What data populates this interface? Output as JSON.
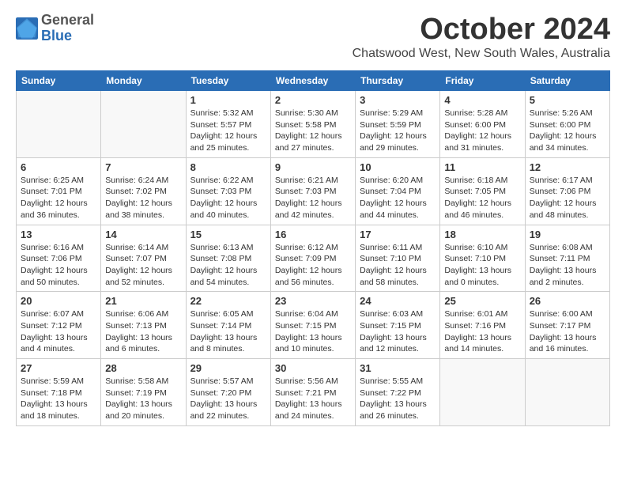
{
  "logo": {
    "text_general": "General",
    "text_blue": "Blue"
  },
  "title": "October 2024",
  "location": "Chatswood West, New South Wales, Australia",
  "days_of_week": [
    "Sunday",
    "Monday",
    "Tuesday",
    "Wednesday",
    "Thursday",
    "Friday",
    "Saturday"
  ],
  "weeks": [
    [
      {
        "day": "",
        "info": ""
      },
      {
        "day": "",
        "info": ""
      },
      {
        "day": "1",
        "info": "Sunrise: 5:32 AM\nSunset: 5:57 PM\nDaylight: 12 hours\nand 25 minutes."
      },
      {
        "day": "2",
        "info": "Sunrise: 5:30 AM\nSunset: 5:58 PM\nDaylight: 12 hours\nand 27 minutes."
      },
      {
        "day": "3",
        "info": "Sunrise: 5:29 AM\nSunset: 5:59 PM\nDaylight: 12 hours\nand 29 minutes."
      },
      {
        "day": "4",
        "info": "Sunrise: 5:28 AM\nSunset: 6:00 PM\nDaylight: 12 hours\nand 31 minutes."
      },
      {
        "day": "5",
        "info": "Sunrise: 5:26 AM\nSunset: 6:00 PM\nDaylight: 12 hours\nand 34 minutes."
      }
    ],
    [
      {
        "day": "6",
        "info": "Sunrise: 6:25 AM\nSunset: 7:01 PM\nDaylight: 12 hours\nand 36 minutes."
      },
      {
        "day": "7",
        "info": "Sunrise: 6:24 AM\nSunset: 7:02 PM\nDaylight: 12 hours\nand 38 minutes."
      },
      {
        "day": "8",
        "info": "Sunrise: 6:22 AM\nSunset: 7:03 PM\nDaylight: 12 hours\nand 40 minutes."
      },
      {
        "day": "9",
        "info": "Sunrise: 6:21 AM\nSunset: 7:03 PM\nDaylight: 12 hours\nand 42 minutes."
      },
      {
        "day": "10",
        "info": "Sunrise: 6:20 AM\nSunset: 7:04 PM\nDaylight: 12 hours\nand 44 minutes."
      },
      {
        "day": "11",
        "info": "Sunrise: 6:18 AM\nSunset: 7:05 PM\nDaylight: 12 hours\nand 46 minutes."
      },
      {
        "day": "12",
        "info": "Sunrise: 6:17 AM\nSunset: 7:06 PM\nDaylight: 12 hours\nand 48 minutes."
      }
    ],
    [
      {
        "day": "13",
        "info": "Sunrise: 6:16 AM\nSunset: 7:06 PM\nDaylight: 12 hours\nand 50 minutes."
      },
      {
        "day": "14",
        "info": "Sunrise: 6:14 AM\nSunset: 7:07 PM\nDaylight: 12 hours\nand 52 minutes."
      },
      {
        "day": "15",
        "info": "Sunrise: 6:13 AM\nSunset: 7:08 PM\nDaylight: 12 hours\nand 54 minutes."
      },
      {
        "day": "16",
        "info": "Sunrise: 6:12 AM\nSunset: 7:09 PM\nDaylight: 12 hours\nand 56 minutes."
      },
      {
        "day": "17",
        "info": "Sunrise: 6:11 AM\nSunset: 7:10 PM\nDaylight: 12 hours\nand 58 minutes."
      },
      {
        "day": "18",
        "info": "Sunrise: 6:10 AM\nSunset: 7:10 PM\nDaylight: 13 hours\nand 0 minutes."
      },
      {
        "day": "19",
        "info": "Sunrise: 6:08 AM\nSunset: 7:11 PM\nDaylight: 13 hours\nand 2 minutes."
      }
    ],
    [
      {
        "day": "20",
        "info": "Sunrise: 6:07 AM\nSunset: 7:12 PM\nDaylight: 13 hours\nand 4 minutes."
      },
      {
        "day": "21",
        "info": "Sunrise: 6:06 AM\nSunset: 7:13 PM\nDaylight: 13 hours\nand 6 minutes."
      },
      {
        "day": "22",
        "info": "Sunrise: 6:05 AM\nSunset: 7:14 PM\nDaylight: 13 hours\nand 8 minutes."
      },
      {
        "day": "23",
        "info": "Sunrise: 6:04 AM\nSunset: 7:15 PM\nDaylight: 13 hours\nand 10 minutes."
      },
      {
        "day": "24",
        "info": "Sunrise: 6:03 AM\nSunset: 7:15 PM\nDaylight: 13 hours\nand 12 minutes."
      },
      {
        "day": "25",
        "info": "Sunrise: 6:01 AM\nSunset: 7:16 PM\nDaylight: 13 hours\nand 14 minutes."
      },
      {
        "day": "26",
        "info": "Sunrise: 6:00 AM\nSunset: 7:17 PM\nDaylight: 13 hours\nand 16 minutes."
      }
    ],
    [
      {
        "day": "27",
        "info": "Sunrise: 5:59 AM\nSunset: 7:18 PM\nDaylight: 13 hours\nand 18 minutes."
      },
      {
        "day": "28",
        "info": "Sunrise: 5:58 AM\nSunset: 7:19 PM\nDaylight: 13 hours\nand 20 minutes."
      },
      {
        "day": "29",
        "info": "Sunrise: 5:57 AM\nSunset: 7:20 PM\nDaylight: 13 hours\nand 22 minutes."
      },
      {
        "day": "30",
        "info": "Sunrise: 5:56 AM\nSunset: 7:21 PM\nDaylight: 13 hours\nand 24 minutes."
      },
      {
        "day": "31",
        "info": "Sunrise: 5:55 AM\nSunset: 7:22 PM\nDaylight: 13 hours\nand 26 minutes."
      },
      {
        "day": "",
        "info": ""
      },
      {
        "day": "",
        "info": ""
      }
    ]
  ]
}
